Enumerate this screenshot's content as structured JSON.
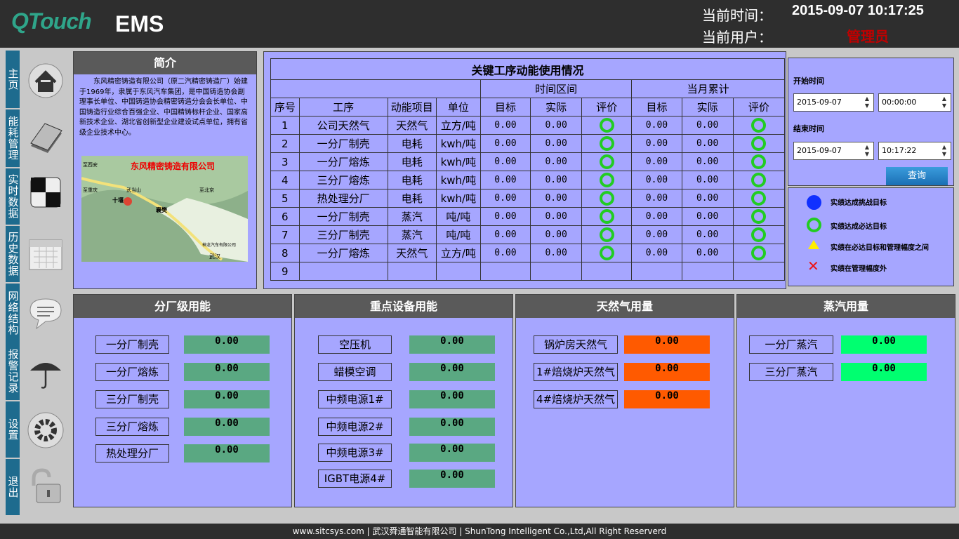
{
  "header": {
    "logo": "QTouch",
    "app": "EMS",
    "time_label": "当前时间：",
    "time_value": "2015-09-07 10:17:25",
    "user_label": "当前用户：",
    "user_value": "管理员"
  },
  "nav": [
    {
      "label": "主页",
      "icon": "home-icon"
    },
    {
      "label": "能耗管理",
      "icon": "book-icon"
    },
    {
      "label": "实时数据",
      "icon": "checker-icon"
    },
    {
      "label": "历史数据",
      "icon": "calendar-icon"
    },
    {
      "label": "网络结构",
      "icon": "chat-icon"
    },
    {
      "label": "报警记录",
      "icon": "umbrella-icon"
    },
    {
      "label": "设置",
      "icon": "gear-icon"
    },
    {
      "label": "退出",
      "icon": "unlock-icon"
    }
  ],
  "intro": {
    "title": "简介",
    "text": "东风精密铸造有限公司（原二汽精密铸造厂）始建于1969年，隶属于东风汽车集团，是中国铸造协会副理事长单位、中国铸造协会精密铸造分会会长单位、中国铸造行业综合百强企业、中国精铸标杆企业、国家高新技术企业、湖北省创新型企业建设试点单位，拥有省级企业技术中心。",
    "map_title": "东风精密铸造有限公司",
    "map_labels": [
      "至西安",
      "至重庆",
      "十堰",
      "武当山",
      "至北京",
      "襄樊",
      "神龙汽车有限公司",
      "武汉"
    ]
  },
  "key_table": {
    "title": "关键工序动能使用情况",
    "group_time": "时间区间",
    "group_month": "当月累计",
    "headers": [
      "序号",
      "工序",
      "动能项目",
      "单位",
      "目标",
      "实际",
      "评价",
      "目标",
      "实际",
      "评价"
    ],
    "rows": [
      {
        "no": "1",
        "proc": "公司天然气",
        "item": "天然气",
        "unit": "立方/吨",
        "t1": "0.00",
        "a1": "0.00",
        "t2": "0.00",
        "a2": "0.00"
      },
      {
        "no": "2",
        "proc": "一分厂制壳",
        "item": "电耗",
        "unit": "kwh/吨",
        "t1": "0.00",
        "a1": "0.00",
        "t2": "0.00",
        "a2": "0.00"
      },
      {
        "no": "3",
        "proc": "一分厂熔炼",
        "item": "电耗",
        "unit": "kwh/吨",
        "t1": "0.00",
        "a1": "0.00",
        "t2": "0.00",
        "a2": "0.00"
      },
      {
        "no": "4",
        "proc": "三分厂熔炼",
        "item": "电耗",
        "unit": "kwh/吨",
        "t1": "0.00",
        "a1": "0.00",
        "t2": "0.00",
        "a2": "0.00"
      },
      {
        "no": "5",
        "proc": "热处理分厂",
        "item": "电耗",
        "unit": "kwh/吨",
        "t1": "0.00",
        "a1": "0.00",
        "t2": "0.00",
        "a2": "0.00"
      },
      {
        "no": "6",
        "proc": "一分厂制壳",
        "item": "蒸汽",
        "unit": "吨/吨",
        "t1": "0.00",
        "a1": "0.00",
        "t2": "0.00",
        "a2": "0.00"
      },
      {
        "no": "7",
        "proc": "三分厂制壳",
        "item": "蒸汽",
        "unit": "吨/吨",
        "t1": "0.00",
        "a1": "0.00",
        "t2": "0.00",
        "a2": "0.00"
      },
      {
        "no": "8",
        "proc": "一分厂熔炼",
        "item": "天然气",
        "unit": "立方/吨",
        "t1": "0.00",
        "a1": "0.00",
        "t2": "0.00",
        "a2": "0.00"
      },
      {
        "no": "9",
        "proc": "",
        "item": "",
        "unit": "",
        "t1": "",
        "a1": "",
        "t2": "",
        "a2": ""
      }
    ]
  },
  "query": {
    "start_label": "开始时间",
    "start_date": "2015-09-07",
    "start_time": "00:00:00",
    "end_label": "结束时间",
    "end_date": "2015-09-07",
    "end_time": "10:17:22",
    "button": "查询"
  },
  "legend": [
    {
      "text": "实绩达成挑战目标",
      "color": "#1030ff"
    },
    {
      "text": "实绩达成必达目标",
      "color": "#22cc22"
    },
    {
      "text": "实绩在必达目标和管理幅度之间",
      "color": "#ffee00"
    },
    {
      "text": "实绩在管理幅度外",
      "color": "#ee1111"
    }
  ],
  "sections": [
    {
      "title": "分厂级用能",
      "color": "#5aa882",
      "items": [
        {
          "label": "一分厂制壳",
          "value": "0.00"
        },
        {
          "label": "一分厂熔炼",
          "value": "0.00"
        },
        {
          "label": "三分厂制壳",
          "value": "0.00"
        },
        {
          "label": "三分厂熔炼",
          "value": "0.00"
        },
        {
          "label": "热处理分厂",
          "value": "0.00"
        }
      ]
    },
    {
      "title": "重点设备用能",
      "color": "#5aa882",
      "items": [
        {
          "label": "空压机",
          "value": "0.00"
        },
        {
          "label": "蜡模空调",
          "value": "0.00"
        },
        {
          "label": "中频电源1#",
          "value": "0.00"
        },
        {
          "label": "中频电源2#",
          "value": "0.00"
        },
        {
          "label": "中频电源3#",
          "value": "0.00"
        },
        {
          "label": "IGBT电源4#",
          "value": "0.00"
        }
      ]
    },
    {
      "title": "天然气用量",
      "color": "#ff5a00",
      "items": [
        {
          "label": "锅炉房天然气",
          "value": "0.00"
        },
        {
          "label": "1#焙烧炉天然气",
          "value": "0.00"
        },
        {
          "label": "4#焙烧炉天然气",
          "value": "0.00"
        }
      ]
    },
    {
      "title": "蒸汽用量",
      "color": "#00ff70",
      "items": [
        {
          "label": "一分厂蒸汽",
          "value": "0.00"
        },
        {
          "label": "三分厂蒸汽",
          "value": "0.00"
        }
      ]
    }
  ],
  "footer": "www.sitcsys.com | 武汉舜通智能有限公司 | ShunTong Intelligent Co.,Ltd,All Right Reserverd"
}
